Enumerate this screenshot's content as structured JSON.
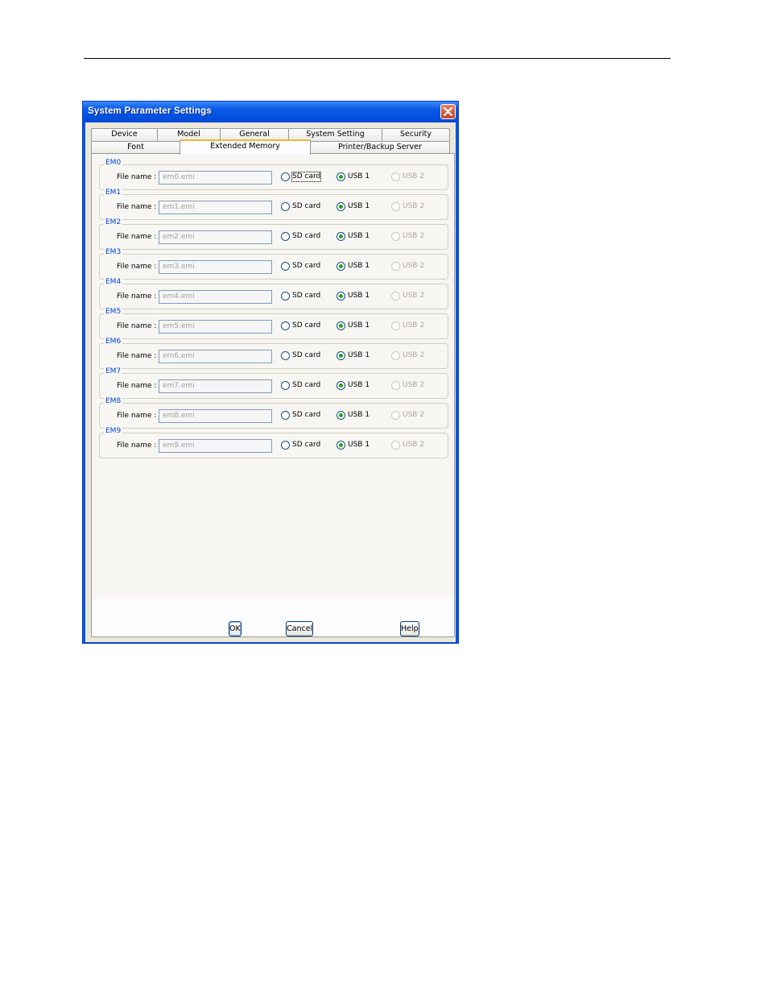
{
  "dialog": {
    "title": "System Parameter Settings"
  },
  "tabs": {
    "row1": [
      "Device",
      "Model",
      "General",
      "System Setting",
      "Security"
    ],
    "row2": [
      "Font",
      "Extended Memory",
      "Printer/Backup Server"
    ],
    "active": "Extended Memory"
  },
  "file_name_label": "File name :",
  "radio_labels": {
    "sd": "SD card",
    "usb1": "USB 1",
    "usb2": "USB 2"
  },
  "groups": [
    {
      "label": "EM0",
      "file": "em0.emi",
      "selected": "USB 1"
    },
    {
      "label": "EM1",
      "file": "em1.emi",
      "selected": "USB 1"
    },
    {
      "label": "EM2",
      "file": "em2.emi",
      "selected": "USB 1"
    },
    {
      "label": "EM3",
      "file": "em3.emi",
      "selected": "USB 1"
    },
    {
      "label": "EM4",
      "file": "em4.emi",
      "selected": "USB 1"
    },
    {
      "label": "EM5",
      "file": "em5.emi",
      "selected": "USB 1"
    },
    {
      "label": "EM6",
      "file": "em6.emi",
      "selected": "USB 1"
    },
    {
      "label": "EM7",
      "file": "em7.emi",
      "selected": "USB 1"
    },
    {
      "label": "EM8",
      "file": "em8.emi",
      "selected": "USB 1"
    },
    {
      "label": "EM9",
      "file": "em9.emi",
      "selected": "USB 1"
    }
  ],
  "buttons": {
    "ok": "OK",
    "cancel": "Cancel",
    "help": "Help"
  },
  "colors": {
    "titlebar": "#0054e3",
    "group_label": "#0046d5",
    "dialog_bg": "#ece9d8"
  }
}
